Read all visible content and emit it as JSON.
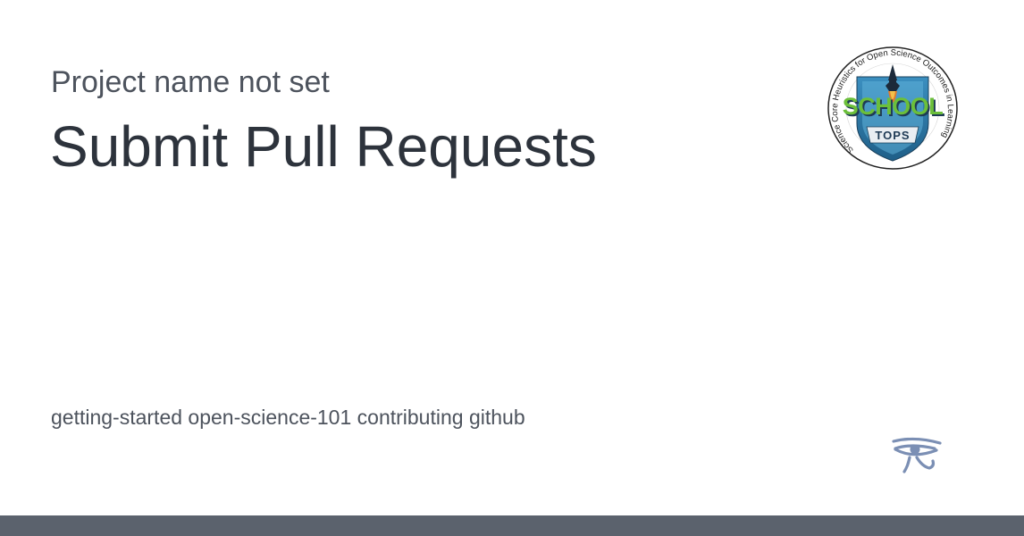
{
  "project": {
    "name": "Project name not set"
  },
  "page": {
    "title": "Submit Pull Requests",
    "tags": "getting-started open-science-101 contributing github"
  },
  "logo": {
    "icon": "school-tops-badge-icon",
    "ring_text": "Science Core Heuristics for Open Science Outcomes in Learning",
    "badge_line1": "SCHOOL",
    "badge_line2": "TOPS",
    "colors": {
      "shield": "#2a7aa8",
      "school": "#6bbf3a",
      "ring": "#222222"
    }
  },
  "footer": {
    "icon": "eye-of-horus-icon",
    "bar_color": "#5b626d"
  }
}
